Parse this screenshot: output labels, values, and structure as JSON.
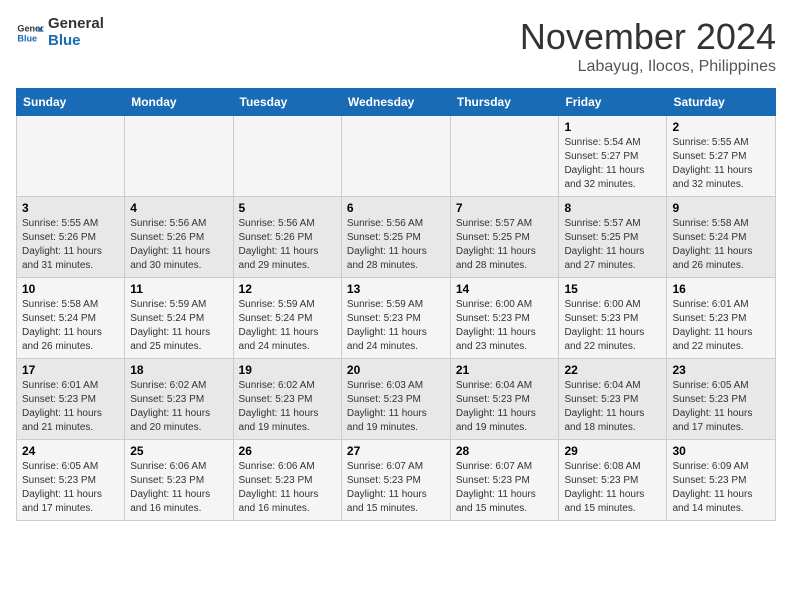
{
  "header": {
    "logo_line1": "General",
    "logo_line2": "Blue",
    "month": "November 2024",
    "location": "Labayug, Ilocos, Philippines"
  },
  "days_of_week": [
    "Sunday",
    "Monday",
    "Tuesday",
    "Wednesday",
    "Thursday",
    "Friday",
    "Saturday"
  ],
  "weeks": [
    [
      {
        "day": "",
        "info": ""
      },
      {
        "day": "",
        "info": ""
      },
      {
        "day": "",
        "info": ""
      },
      {
        "day": "",
        "info": ""
      },
      {
        "day": "",
        "info": ""
      },
      {
        "day": "1",
        "info": "Sunrise: 5:54 AM\nSunset: 5:27 PM\nDaylight: 11 hours and 32 minutes."
      },
      {
        "day": "2",
        "info": "Sunrise: 5:55 AM\nSunset: 5:27 PM\nDaylight: 11 hours and 32 minutes."
      }
    ],
    [
      {
        "day": "3",
        "info": "Sunrise: 5:55 AM\nSunset: 5:26 PM\nDaylight: 11 hours and 31 minutes."
      },
      {
        "day": "4",
        "info": "Sunrise: 5:56 AM\nSunset: 5:26 PM\nDaylight: 11 hours and 30 minutes."
      },
      {
        "day": "5",
        "info": "Sunrise: 5:56 AM\nSunset: 5:26 PM\nDaylight: 11 hours and 29 minutes."
      },
      {
        "day": "6",
        "info": "Sunrise: 5:56 AM\nSunset: 5:25 PM\nDaylight: 11 hours and 28 minutes."
      },
      {
        "day": "7",
        "info": "Sunrise: 5:57 AM\nSunset: 5:25 PM\nDaylight: 11 hours and 28 minutes."
      },
      {
        "day": "8",
        "info": "Sunrise: 5:57 AM\nSunset: 5:25 PM\nDaylight: 11 hours and 27 minutes."
      },
      {
        "day": "9",
        "info": "Sunrise: 5:58 AM\nSunset: 5:24 PM\nDaylight: 11 hours and 26 minutes."
      }
    ],
    [
      {
        "day": "10",
        "info": "Sunrise: 5:58 AM\nSunset: 5:24 PM\nDaylight: 11 hours and 26 minutes."
      },
      {
        "day": "11",
        "info": "Sunrise: 5:59 AM\nSunset: 5:24 PM\nDaylight: 11 hours and 25 minutes."
      },
      {
        "day": "12",
        "info": "Sunrise: 5:59 AM\nSunset: 5:24 PM\nDaylight: 11 hours and 24 minutes."
      },
      {
        "day": "13",
        "info": "Sunrise: 5:59 AM\nSunset: 5:23 PM\nDaylight: 11 hours and 24 minutes."
      },
      {
        "day": "14",
        "info": "Sunrise: 6:00 AM\nSunset: 5:23 PM\nDaylight: 11 hours and 23 minutes."
      },
      {
        "day": "15",
        "info": "Sunrise: 6:00 AM\nSunset: 5:23 PM\nDaylight: 11 hours and 22 minutes."
      },
      {
        "day": "16",
        "info": "Sunrise: 6:01 AM\nSunset: 5:23 PM\nDaylight: 11 hours and 22 minutes."
      }
    ],
    [
      {
        "day": "17",
        "info": "Sunrise: 6:01 AM\nSunset: 5:23 PM\nDaylight: 11 hours and 21 minutes."
      },
      {
        "day": "18",
        "info": "Sunrise: 6:02 AM\nSunset: 5:23 PM\nDaylight: 11 hours and 20 minutes."
      },
      {
        "day": "19",
        "info": "Sunrise: 6:02 AM\nSunset: 5:23 PM\nDaylight: 11 hours and 19 minutes."
      },
      {
        "day": "20",
        "info": "Sunrise: 6:03 AM\nSunset: 5:23 PM\nDaylight: 11 hours and 19 minutes."
      },
      {
        "day": "21",
        "info": "Sunrise: 6:04 AM\nSunset: 5:23 PM\nDaylight: 11 hours and 19 minutes."
      },
      {
        "day": "22",
        "info": "Sunrise: 6:04 AM\nSunset: 5:23 PM\nDaylight: 11 hours and 18 minutes."
      },
      {
        "day": "23",
        "info": "Sunrise: 6:05 AM\nSunset: 5:23 PM\nDaylight: 11 hours and 17 minutes."
      }
    ],
    [
      {
        "day": "24",
        "info": "Sunrise: 6:05 AM\nSunset: 5:23 PM\nDaylight: 11 hours and 17 minutes."
      },
      {
        "day": "25",
        "info": "Sunrise: 6:06 AM\nSunset: 5:23 PM\nDaylight: 11 hours and 16 minutes."
      },
      {
        "day": "26",
        "info": "Sunrise: 6:06 AM\nSunset: 5:23 PM\nDaylight: 11 hours and 16 minutes."
      },
      {
        "day": "27",
        "info": "Sunrise: 6:07 AM\nSunset: 5:23 PM\nDaylight: 11 hours and 15 minutes."
      },
      {
        "day": "28",
        "info": "Sunrise: 6:07 AM\nSunset: 5:23 PM\nDaylight: 11 hours and 15 minutes."
      },
      {
        "day": "29",
        "info": "Sunrise: 6:08 AM\nSunset: 5:23 PM\nDaylight: 11 hours and 15 minutes."
      },
      {
        "day": "30",
        "info": "Sunrise: 6:09 AM\nSunset: 5:23 PM\nDaylight: 11 hours and 14 minutes."
      }
    ]
  ]
}
